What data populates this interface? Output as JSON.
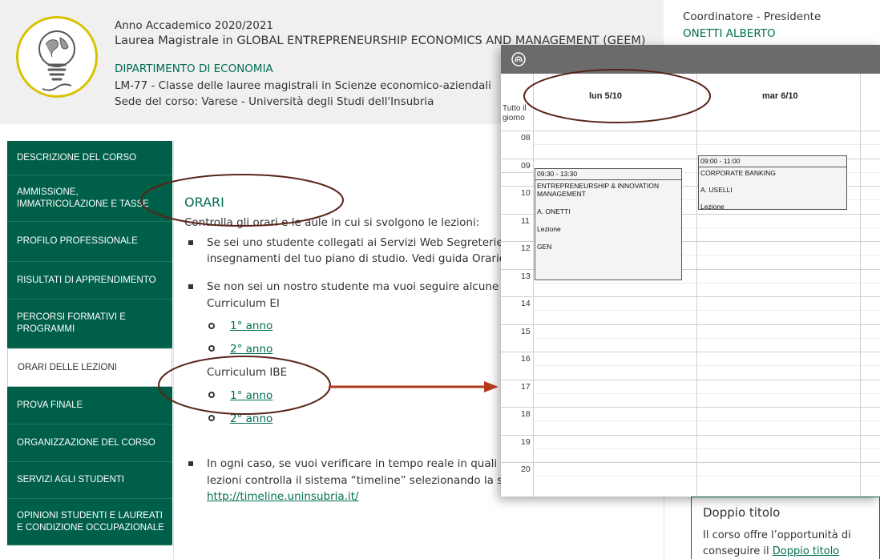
{
  "header": {
    "year": "Anno Accademico 2020/2021",
    "degree": "Laurea Magistrale in GLOBAL ENTREPRENEURSHIP ECONOMICS AND MANAGEMENT (GEEM)",
    "department": "DIPARTIMENTO DI ECONOMIA",
    "class": "LM-77 - Classe delle lauree magistrali in Scienze economico-aziendali",
    "seat": "Sede del corso: Varese - Università degli Studi dell'Insubria"
  },
  "coordinator": {
    "label": "Coordinatore - Presidente",
    "name": "ONETTI ALBERTO"
  },
  "sidebar": {
    "items": [
      {
        "label": "DESCRIZIONE DEL CORSO",
        "active": false
      },
      {
        "label": "AMMISSIONE, IMMATRICOLAZIONE E TASSE",
        "active": false
      },
      {
        "label": "PROFILO PROFESSIONALE",
        "active": false
      },
      {
        "label": "RISULTATI DI APPRENDIMENTO",
        "active": false
      },
      {
        "label": "PERCORSI FORMATIVI E PROGRAMMI",
        "active": false
      },
      {
        "label": "ORARI DELLE LEZIONI",
        "active": true
      },
      {
        "label": "PROVA FINALE",
        "active": false
      },
      {
        "label": "ORGANIZZAZIONE DEL CORSO",
        "active": false
      },
      {
        "label": "SERVIZI AGLI STUDENTI",
        "active": false
      },
      {
        "label": "OPINIONI STUDENTI E LAUREATI E CONDIZIONE OCCUPAZIONALE",
        "active": false
      }
    ]
  },
  "main": {
    "title": "ORARI",
    "intro": "Controlla gli orari e le aule in cui si svolgono le lezioni:",
    "bullet1_line1": "Se sei uno studente collegati ai Servizi Web Segreterie stud",
    "bullet1_line2": "insegnamenti del tuo piano di studio. Vedi guida Orario pers",
    "bullet2_line1": "Se non sei un nostro studente ma vuoi seguire alcune lezio",
    "curriculum_ei": "Curriculum EI",
    "ei_links": [
      "1° anno",
      "2° anno"
    ],
    "curriculum_ibe": "Curriculum IBE",
    "ibe_links": [
      "1° anno",
      "2° anno"
    ],
    "bullet3_line1": "In ogni caso, se vuoi verificare in tempo reale in quali aule s",
    "bullet3_line2": "lezioni controlla il sistema “timeline” selezionando la sede (",
    "timeline_link": "http://timeline.uninsubria.it/"
  },
  "card": {
    "title": "Doppio titolo",
    "line1": "Il corso offre l’opportunità di",
    "line2_prefix": "conseguire il ",
    "line2_link": "Doppio titolo"
  },
  "calendar": {
    "days": [
      "lun 5/10",
      "mar 6/10"
    ],
    "allday_line1": "Tutto il",
    "allday_line2": "giorno",
    "hours": [
      "08",
      "09",
      "10",
      "11",
      "12",
      "13",
      "14",
      "15",
      "16",
      "17",
      "18",
      "19",
      "20"
    ],
    "events": [
      {
        "time": "09:30 - 13:30",
        "title_line1": "ENTREPRENEURSHIP & INNOVATION",
        "title_line2": "MANAGEMENT",
        "teacher": "A. ONETTI",
        "type": "Lezione",
        "room": "GEN"
      },
      {
        "time": "09:00 - 11:00",
        "title_line1": "CORPORATE BANKING",
        "teacher": "A. USELLI",
        "type": "Lezione"
      }
    ]
  },
  "colors": {
    "brand_green": "#005f48",
    "link_green": "#006e52",
    "annotation_red": "#b23a1e",
    "calendar_bar": "#6b6b6b"
  },
  "icons": [
    "lightbulb-globe-logo-icon",
    "university-logo-icon"
  ]
}
